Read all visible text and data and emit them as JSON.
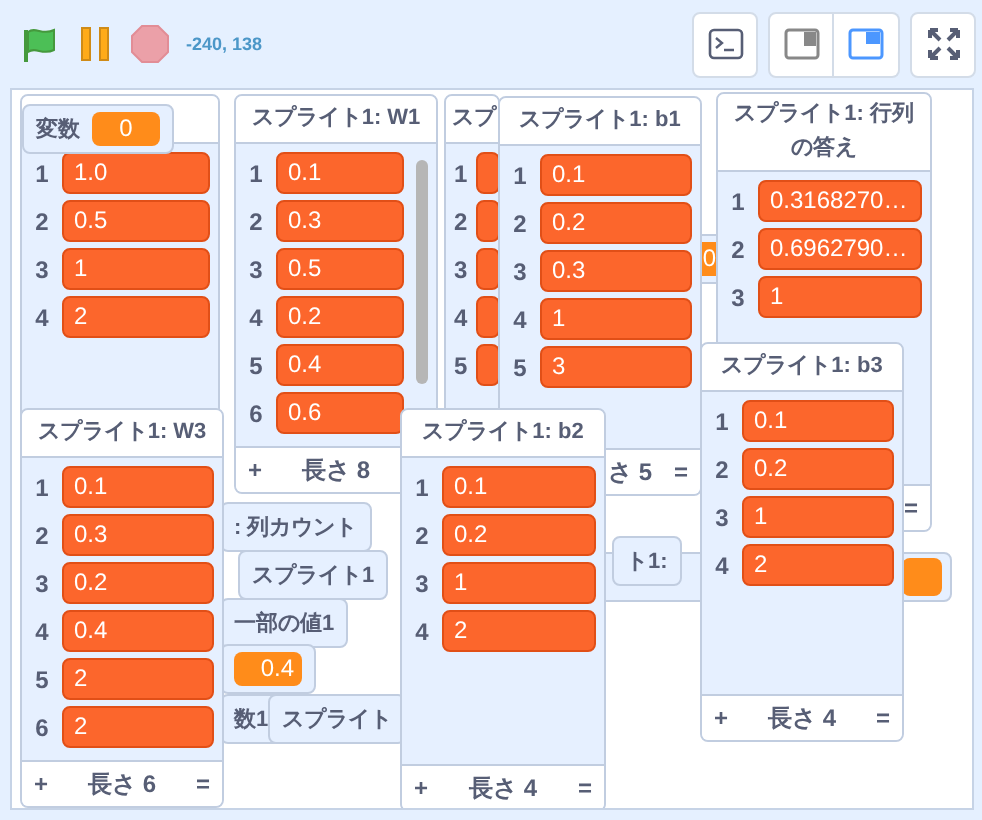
{
  "toolbar": {
    "coordinates": "-240, 138",
    "stage_modes": [
      {
        "selected": false
      },
      {
        "selected": true
      }
    ]
  },
  "monitors": [
    {
      "kind": "variable",
      "label": "変数",
      "value": "0"
    },
    {
      "kind": "list",
      "items": [
        {
          "index": "1",
          "value": "1.0"
        },
        {
          "index": "2",
          "value": "0.5"
        },
        {
          "index": "3",
          "value": "1"
        },
        {
          "index": "4",
          "value": "2"
        }
      ]
    },
    {
      "kind": "list",
      "title": "スプライト1: W1",
      "scrollbar": true,
      "items": [
        {
          "index": "1",
          "value": "0.1"
        },
        {
          "index": "2",
          "value": "0.3"
        },
        {
          "index": "3",
          "value": "0.5"
        },
        {
          "index": "4",
          "value": "0.2"
        },
        {
          "index": "5",
          "value": "0.4"
        },
        {
          "index": "6",
          "value": "0.6"
        }
      ],
      "footer": {
        "plus": "+",
        "length": "長さ 8"
      }
    },
    {
      "kind": "list",
      "title": "スプ",
      "items": [
        {
          "index": "1"
        },
        {
          "index": "2"
        },
        {
          "index": "3"
        },
        {
          "index": "4"
        },
        {
          "index": "5"
        }
      ]
    },
    {
      "kind": "list",
      "title": "スプライト1: b1",
      "items": [
        {
          "index": "1",
          "value": "0.1"
        },
        {
          "index": "2",
          "value": "0.2"
        },
        {
          "index": "3",
          "value": "0.3"
        },
        {
          "index": "4",
          "value": "1"
        },
        {
          "index": "5",
          "value": "3"
        }
      ],
      "footer": {
        "length": "さ 5",
        "eq": "="
      }
    },
    {
      "kind": "list",
      "title": "スプライト1: 行列の答え",
      "items": [
        {
          "index": "1",
          "value": "0.3168270…"
        },
        {
          "index": "2",
          "value": "0.6962790…"
        },
        {
          "index": "3",
          "value": "1"
        }
      ],
      "footer": {
        "eq": "="
      }
    },
    {
      "kind": "variable",
      "value": "0"
    },
    {
      "kind": "list",
      "title": "スプライト1: b3",
      "items": [
        {
          "index": "1",
          "value": "0.1"
        },
        {
          "index": "2",
          "value": "0.2"
        },
        {
          "index": "3",
          "value": "1"
        },
        {
          "index": "4",
          "value": "2"
        }
      ],
      "footer": {
        "plus": "+",
        "length": "長さ 4",
        "eq": "="
      }
    },
    {
      "kind": "list",
      "title": "スプライト1: W3",
      "items": [
        {
          "index": "1",
          "value": "0.1"
        },
        {
          "index": "2",
          "value": "0.3"
        },
        {
          "index": "3",
          "value": "0.2"
        },
        {
          "index": "4",
          "value": "0.4"
        },
        {
          "index": "5",
          "value": "2"
        },
        {
          "index": "6",
          "value": "2"
        }
      ],
      "footer": {
        "plus": "+",
        "length": "長さ 6",
        "eq": "="
      }
    },
    {
      "kind": "list",
      "title": "スプライト1: b2",
      "items": [
        {
          "index": "1",
          "value": "0.1"
        },
        {
          "index": "2",
          "value": "0.2"
        },
        {
          "index": "3",
          "value": "1"
        },
        {
          "index": "4",
          "value": "2"
        }
      ],
      "footer": {
        "plus": "+",
        "length": "長さ 4",
        "eq": "="
      }
    },
    {
      "kind": "variable",
      "label": ": 列カウント"
    },
    {
      "kind": "variable",
      "label": "ト1:"
    },
    {
      "kind": "blank"
    },
    {
      "kind": "variable",
      "label": "スプライト1"
    },
    {
      "kind": "variable",
      "label": "一部の値1"
    },
    {
      "kind": "variable",
      "value": "0.4"
    },
    {
      "kind": "variable",
      "label": "数1"
    },
    {
      "kind": "variable",
      "label": "スプライト"
    }
  ]
}
